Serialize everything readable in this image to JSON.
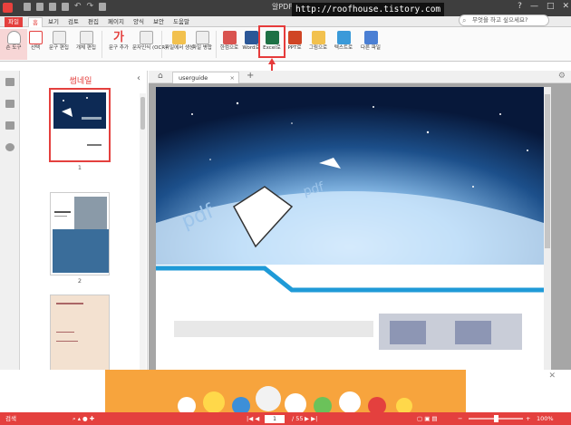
{
  "title_bar": {
    "title": "알PDF",
    "url_badge": "http://roofhouse.tistory.com",
    "search_placeholder": "무엇을 하고 싶으세요?",
    "window_controls": [
      "?",
      "—",
      "□",
      "✕"
    ]
  },
  "menu": {
    "file": "파일",
    "tabs": [
      "홈",
      "보기",
      "검토",
      "편집",
      "페이지",
      "양식",
      "보안",
      "도움말"
    ]
  },
  "ribbon": {
    "buttons": [
      {
        "label": "손 도구",
        "icon": "hand-icon"
      },
      {
        "label": "선택",
        "icon": "select-icon"
      },
      {
        "label": "문구 편집",
        "icon": "edit-text-icon"
      },
      {
        "label": "개체 편집",
        "icon": "edit-object-icon"
      },
      {
        "label": "문구 추가",
        "icon": "add-text-icon"
      },
      {
        "label": "문자인식 (OCR)",
        "icon": "ocr-icon"
      },
      {
        "label": "파일에서 생성",
        "icon": "folder-icon"
      },
      {
        "label": "파일 병합",
        "icon": "merge-icon"
      },
      {
        "label": "한컴으로",
        "icon": "hwp-icon"
      },
      {
        "label": "Word로",
        "icon": "word-icon"
      },
      {
        "label": "Excel로",
        "icon": "excel-icon"
      },
      {
        "label": "PPT로",
        "icon": "ppt-icon"
      },
      {
        "label": "그림으로",
        "icon": "image-icon"
      },
      {
        "label": "텍스트로",
        "icon": "text-icon"
      },
      {
        "label": "다른 파일",
        "icon": "other-file-icon"
      }
    ]
  },
  "thumbnail_panel": {
    "title": "썸네일",
    "pages": [
      "1",
      "2"
    ]
  },
  "document": {
    "tab_label": "userguide",
    "watermark": "pdf"
  },
  "status": {
    "left_label": "검색",
    "page_current": "1",
    "page_total": "/ 55",
    "zoom": "100%"
  },
  "colors": {
    "accent": "#e4403e",
    "ribbon_bg": "#fafafa",
    "doc_bg": "#a6a6a6"
  }
}
